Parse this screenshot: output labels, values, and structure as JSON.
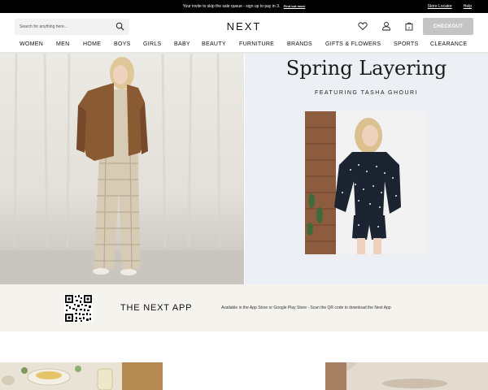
{
  "promo_bar": {
    "message": "Your invite to skip the sale queue - sign up to pay in 3.",
    "link": "Find out more",
    "store_locator": "Store Locator",
    "help": "Help"
  },
  "header": {
    "search_placeholder": "Search for anything here...",
    "logo": "NEXT",
    "checkout_label": "CHECKOUT"
  },
  "nav": {
    "items": [
      "WOMEN",
      "MEN",
      "HOME",
      "BOYS",
      "GIRLS",
      "BABY",
      "BEAUTY",
      "FURNITURE",
      "BRANDS",
      "GIFTS & FLOWERS",
      "SPORTS",
      "CLEARANCE"
    ]
  },
  "hero": {
    "headline": "Spring Layering",
    "subheading": "FEATURING TASHA GHOURI"
  },
  "app_banner": {
    "title": "THE NEXT APP",
    "description": "Available in the App Store or Google Play Store - Scan the QR code to download the Next App"
  },
  "colors": {
    "checkout_bg": "#c4c4c4",
    "hero_right_bg": "#ecf0f5",
    "app_banner_bg": "#f4f3ee",
    "promo_bg": "#000000"
  },
  "icons": [
    "search-icon",
    "heart-icon",
    "user-icon",
    "bag-icon",
    "qr-code-icon"
  ]
}
